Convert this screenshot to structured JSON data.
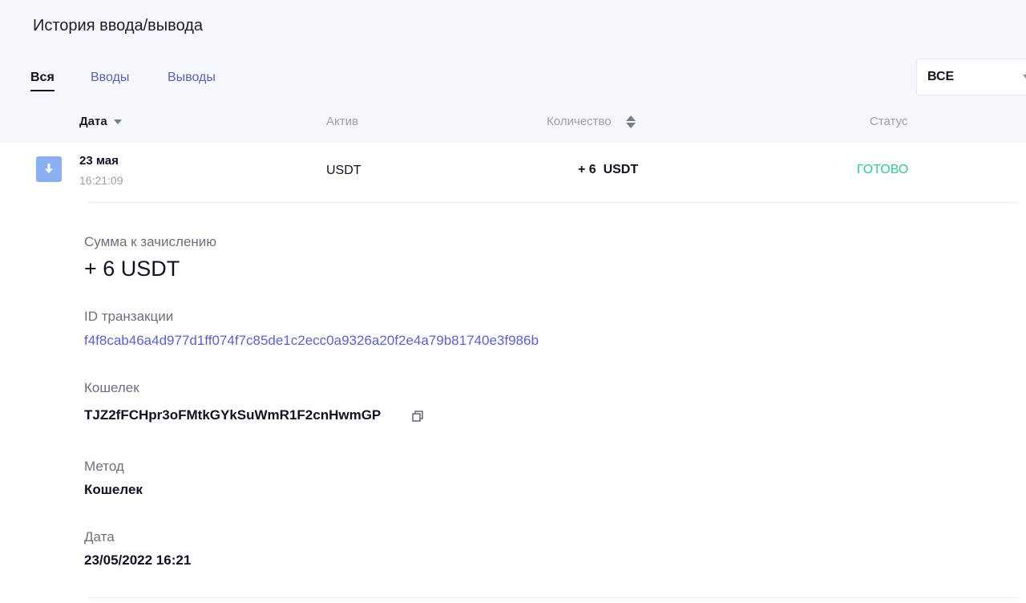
{
  "page_title": "История ввода/вывода",
  "tabs": [
    {
      "label": "Вся",
      "active": true
    },
    {
      "label": "Вводы",
      "active": false
    },
    {
      "label": "Выводы",
      "active": false
    }
  ],
  "filter": {
    "selected": "ВСЕ"
  },
  "table": {
    "columns": {
      "date": "Дата",
      "asset": "Актив",
      "quantity": "Количество",
      "status": "Статус"
    },
    "rows": [
      {
        "type_icon": "arrow-down-icon",
        "date": "23 мая",
        "time": "16:21:09",
        "asset": "USDT",
        "quantity": "+ 6  USDT",
        "status": "ГОТОВО"
      }
    ]
  },
  "details": {
    "amount_label": "Сумма к зачислению",
    "amount_value": "+ 6 USDT",
    "txid_label": "ID транзакции",
    "txid_value": "f4f8cab46a4d977d1ff074f7c85de1c2ecc0a9326a20f2e4a79b81740e3f986b",
    "wallet_label": "Кошелек",
    "wallet_value": "TJZ2fFCHpr3oFMtkGYkSuWmR1F2cnHwmGP",
    "method_label": "Метод",
    "method_value": "Кошелек",
    "date_label": "Дата",
    "date_value": "23/05/2022 16:21"
  },
  "colors": {
    "accent": "#5b62c9",
    "status_done": "#34c98a",
    "deposit_icon_bg": "#8ab0f3"
  }
}
